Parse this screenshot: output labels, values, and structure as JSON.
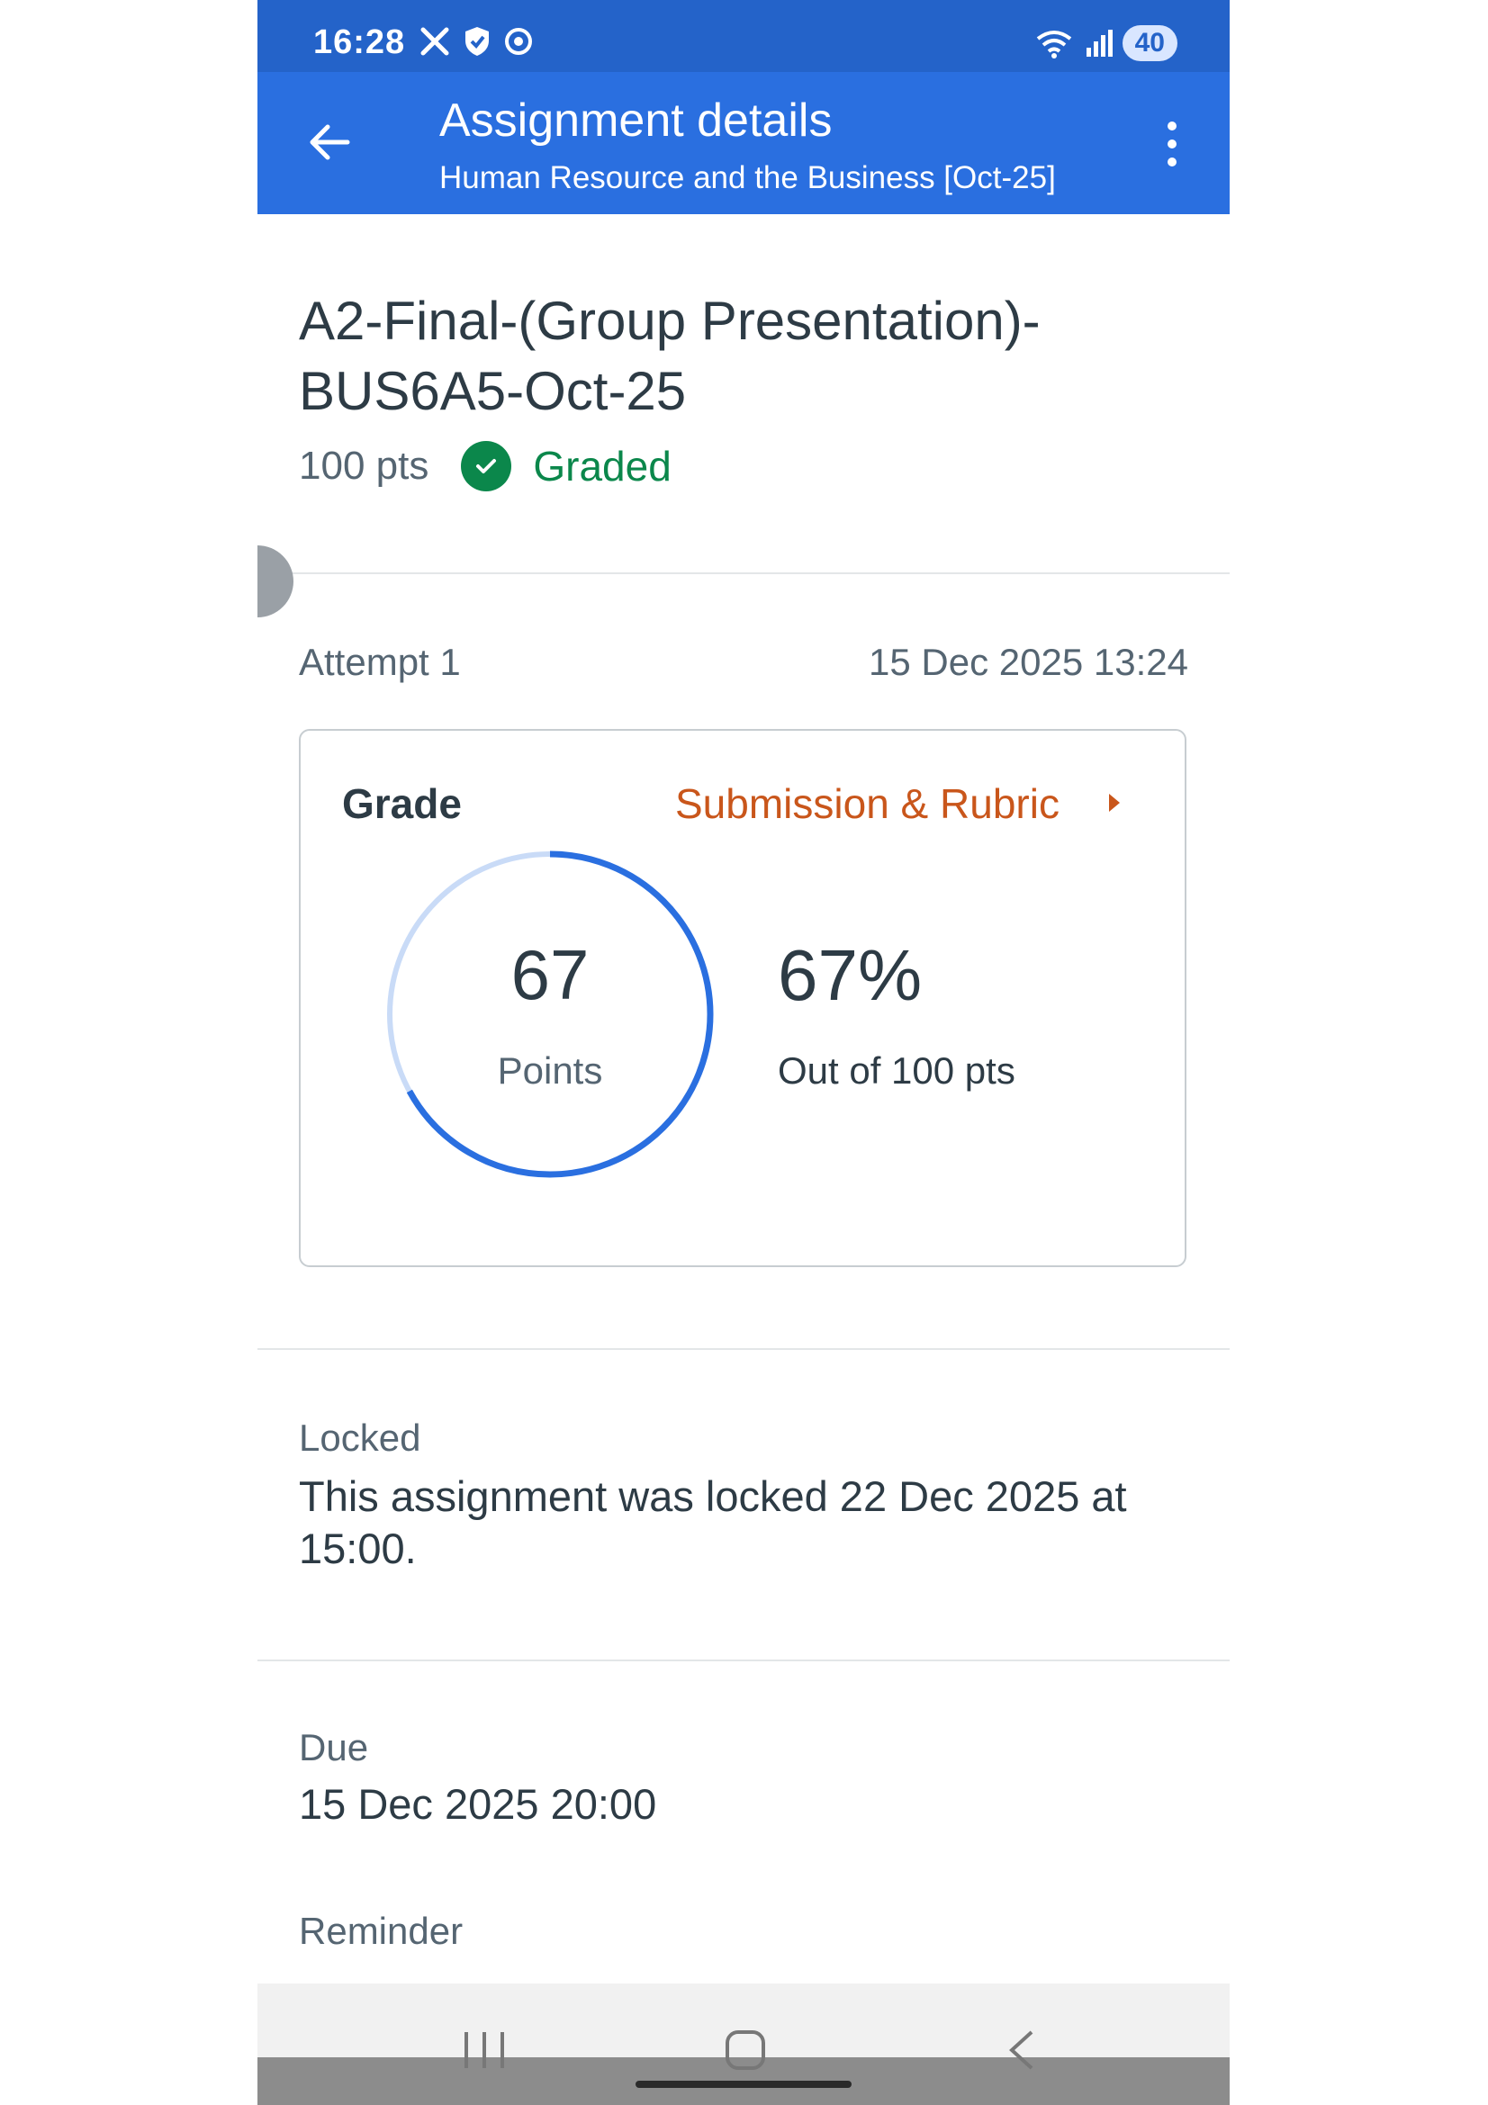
{
  "status_bar": {
    "time": "16:28",
    "battery": "40",
    "icons": [
      "x-logo-icon",
      "shield-icon",
      "chrome-icon",
      "wifi-icon",
      "signal-icon"
    ]
  },
  "app_bar": {
    "title": "Assignment details",
    "subtitle": "Human Resource and the Business [Oct-25]",
    "back_icon": "arrow-left-icon",
    "menu_icon": "more-vertical-icon"
  },
  "assignment": {
    "title": "A2-Final-(Group Presentation)-BUS6A5-Oct-25",
    "points": "100 pts",
    "status": "Graded"
  },
  "attempt": {
    "label": "Attempt 1",
    "date": "15 Dec 2025 13:24"
  },
  "grade_card": {
    "grade_label": "Grade",
    "rubric_link": "Submission & Rubric",
    "score": "67",
    "score_unit": "Points",
    "percent": "67%",
    "out_of": "Out of 100 pts",
    "progress": 0.67
  },
  "locked": {
    "label": "Locked",
    "text": "This assignment was locked 22 Dec 2025 at 15:00."
  },
  "due": {
    "label": "Due",
    "date": "15 Dec 2025 20:00"
  },
  "reminder": {
    "label": "Reminder"
  },
  "colors": {
    "app_bar": "#2a6fe0",
    "status_bar": "#2463c9",
    "graded_green": "#0b874b",
    "rubric_orange": "#c9561b",
    "ring_blue": "#2a6fe0",
    "ring_track": "#c9dbf7"
  }
}
